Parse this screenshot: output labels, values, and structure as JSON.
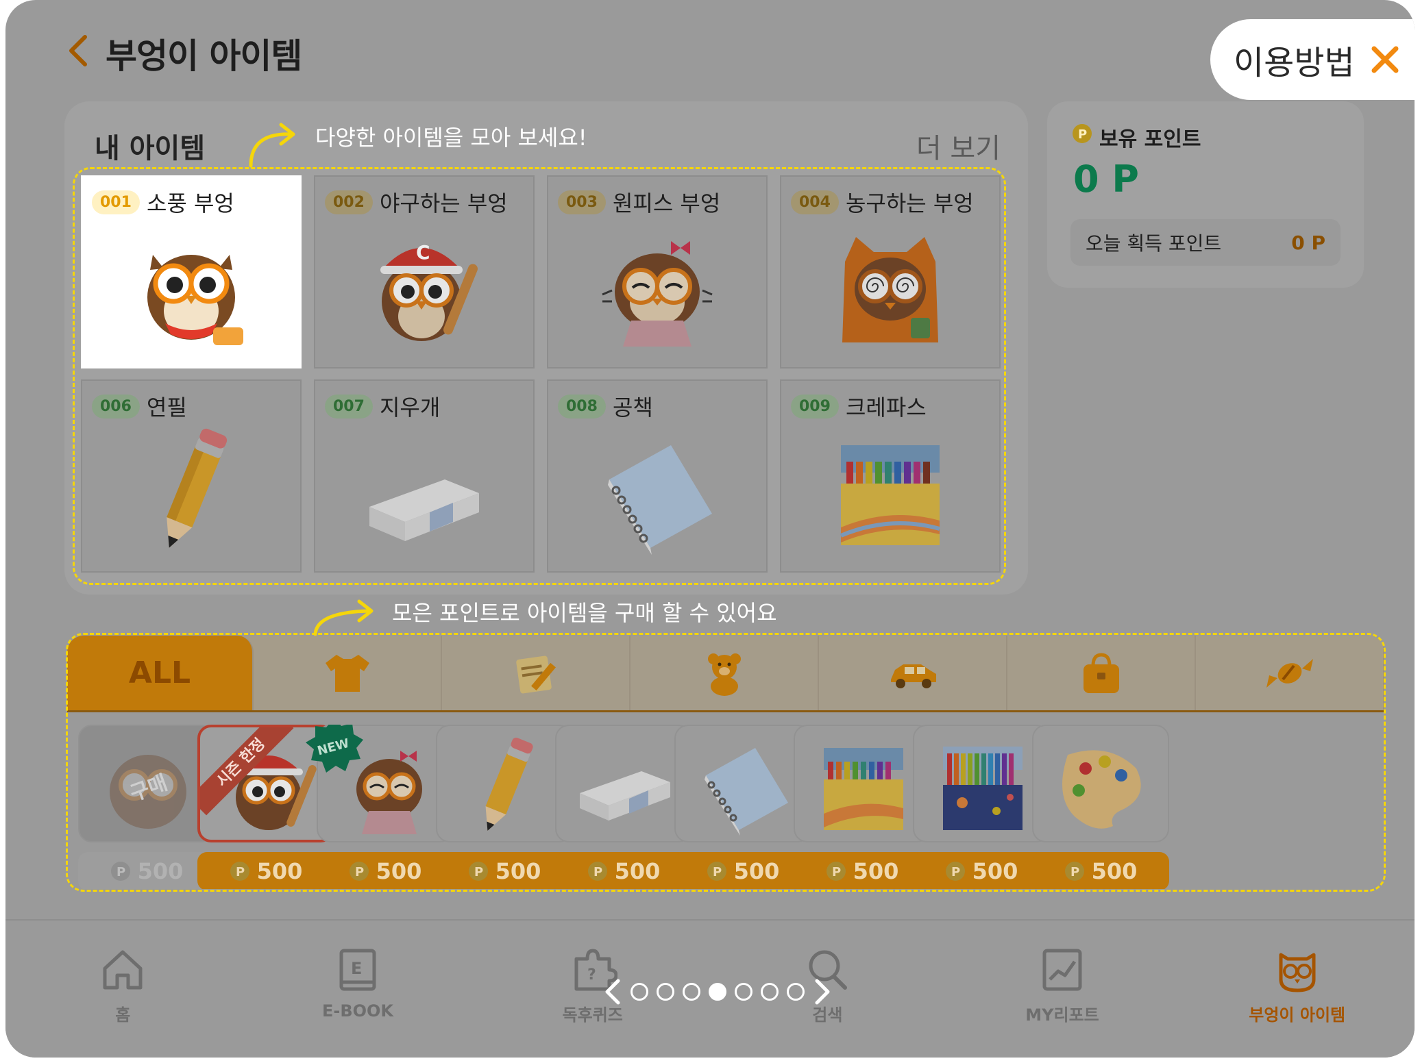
{
  "header": {
    "title": "부엉이 아이템",
    "howto_label": "이용방법"
  },
  "my_items": {
    "title": "내 아이템",
    "more": "더 보기",
    "guide": "다양한 아이템을 모아 보세요!",
    "cards": [
      {
        "code": "001",
        "name": "소풍 부엉",
        "kind": "owl",
        "icon": "picnic-owl-icon",
        "selected": true
      },
      {
        "code": "002",
        "name": "야구하는 부엉",
        "kind": "owl",
        "icon": "baseball-owl-icon"
      },
      {
        "code": "003",
        "name": "원피스 부엉",
        "kind": "owl",
        "icon": "dress-owl-icon"
      },
      {
        "code": "004",
        "name": "농구하는 부엉",
        "kind": "owl",
        "icon": "hoodie-owl-icon"
      },
      {
        "code": "006",
        "name": "연필",
        "kind": "supply",
        "icon": "pencil-icon"
      },
      {
        "code": "007",
        "name": "지우개",
        "kind": "supply",
        "icon": "eraser-icon"
      },
      {
        "code": "008",
        "name": "공책",
        "kind": "supply",
        "icon": "notebook-icon"
      },
      {
        "code": "009",
        "name": "크레파스",
        "kind": "supply",
        "icon": "crayon-box-icon"
      }
    ]
  },
  "points": {
    "label": "보유 포인트",
    "value": "0 P",
    "today_label": "오늘 획득 포인트",
    "today_value": "0 P"
  },
  "shop": {
    "guide": "모은 포인트로 아이템을 구매 할 수 있어요",
    "tabs": [
      {
        "label": "ALL",
        "icon": "all",
        "active": true
      },
      {
        "label": "",
        "icon": "tshirt-icon"
      },
      {
        "label": "",
        "icon": "notepad-icon"
      },
      {
        "label": "",
        "icon": "teddy-bear-icon"
      },
      {
        "label": "",
        "icon": "car-icon"
      },
      {
        "label": "",
        "icon": "bag-icon"
      },
      {
        "label": "",
        "icon": "candy-icon"
      }
    ],
    "items": [
      {
        "icon": "owl-icon",
        "price": "500",
        "owned": true,
        "overlay": "구매"
      },
      {
        "icon": "baseball-owl-icon",
        "price": "500",
        "ribbon": "시즌 한정",
        "selected": true
      },
      {
        "icon": "dress-owl-icon",
        "price": "500",
        "badge": "NEW"
      },
      {
        "icon": "pencil-icon",
        "price": "500"
      },
      {
        "icon": "eraser-icon",
        "price": "500"
      },
      {
        "icon": "notebook-icon",
        "price": "500"
      },
      {
        "icon": "crayon-box-icon",
        "price": "500"
      },
      {
        "icon": "color-pencils-icon",
        "price": "500"
      },
      {
        "icon": "palette-icon",
        "price": "500"
      }
    ]
  },
  "nav": [
    {
      "label": "홈",
      "icon": "home-icon"
    },
    {
      "label": "E-BOOK",
      "icon": "ebook-icon"
    },
    {
      "label": "독후퀴즈",
      "icon": "puzzle-icon"
    },
    {
      "label": "검색",
      "icon": "search-icon"
    },
    {
      "label": "MY리포트",
      "icon": "report-icon"
    },
    {
      "label": "부엉이 아이템",
      "icon": "owl-nav-icon",
      "active": true
    }
  ],
  "pager": {
    "total": 7,
    "current": 4
  },
  "colors": {
    "accent": "#c17a0a",
    "guide": "#f5d60a",
    "point_green": "#0c7a4c"
  }
}
